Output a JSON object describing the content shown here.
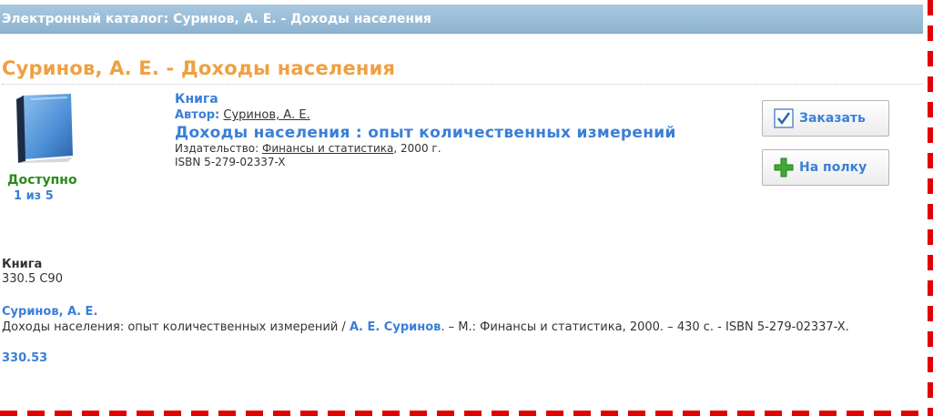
{
  "header": {
    "breadcrumb": "Электронный каталог: Суринов, А. Е. - Доходы населения"
  },
  "page": {
    "title": "Суринов, А. Е. - Доходы населения"
  },
  "availability": {
    "status": "Доступно",
    "count": "1 из 5",
    "status_color": "#2a8a1a"
  },
  "record": {
    "type": "Книга",
    "author_label": "Автор:",
    "author": "Суринов, А. Е.",
    "title": "Доходы населения : опыт количественных измерений",
    "publisher_label": "Издательство:",
    "publisher": "Финансы и статистика",
    "publisher_year": ", 2000 г.",
    "isbn": "ISBN 5-279-02337-X"
  },
  "actions": {
    "order_label": "Заказать",
    "order_icon": "checkbox-check-icon",
    "shelf_label": "На полку",
    "shelf_icon": "plus-icon"
  },
  "description": {
    "type": "Книга",
    "shelfmark": "330.5 С90",
    "author_heading": "Суринов, А. Е.",
    "citation_before": "Доходы населения: опыт количественных измерений / ",
    "citation_author": "А. Е. Суринов",
    "citation_after": ". – М.: Финансы и статистика, 2000. – 430 с. - ISBN 5-279-02337-X.",
    "udc": "330.53"
  },
  "colors": {
    "accent_blue": "#3a7fd8",
    "title_orange": "#f0a040",
    "header_blue": "#9cbfd9",
    "frame_red": "#e30000"
  }
}
